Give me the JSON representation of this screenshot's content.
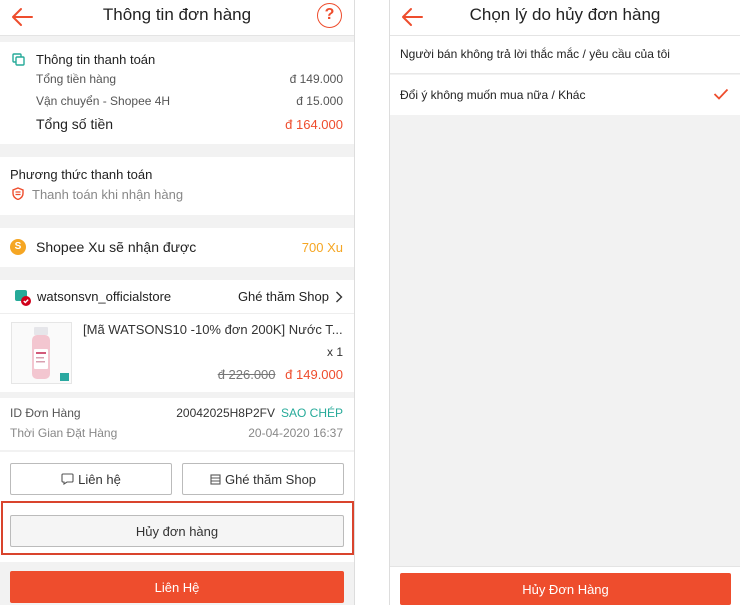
{
  "order_info": {
    "header": {
      "title": "Thông tin đơn hàng",
      "help_symbol": "?"
    },
    "payment_info": {
      "heading": "Thông tin thanh toán",
      "rows": [
        {
          "label": "Tổng tiền hàng",
          "value": "đ 149.000"
        },
        {
          "label": "Vận chuyển - Shopee 4H",
          "value": "đ 15.000"
        }
      ],
      "total_label": "Tổng số tiền",
      "total_value": "đ 164.000"
    },
    "payment_method": {
      "heading": "Phương thức thanh toán",
      "value": "Thanh toán khi nhận hàng"
    },
    "coins": {
      "label": "Shopee Xu sẽ nhận được",
      "value": "700 Xu",
      "coin_symbol": "S"
    },
    "shop": {
      "name": "watsonsvn_officialstore",
      "visit_label": "Ghé thăm Shop",
      "product": {
        "title": "[Mã WATSONS10 -10% đơn 200K] Nước T...",
        "quantity": "x 1",
        "original_price": "đ 226.000",
        "price": "đ 149.000"
      }
    },
    "order_meta": {
      "id_label": "ID Đơn Hàng",
      "id_value": "20042025H8P2FV",
      "copy_label": "SAO CHÉP",
      "time_label": "Thời Gian Đặt Hàng",
      "time_value": "20-04-2020 16:37"
    },
    "actions": {
      "contact_label": "Liên hệ",
      "visit_shop_label": "Ghé thăm Shop",
      "cancel_label": "Hủy đơn hàng",
      "primary_contact_label": "Liên Hệ"
    }
  },
  "cancel_reason": {
    "header": {
      "title": "Chọn lý do hủy đơn hàng"
    },
    "reasons": [
      {
        "label": "Người bán không trả lời thắc mắc / yêu cầu của tôi",
        "selected": false
      },
      {
        "label": "Đổi ý không muốn mua nữa / Khác",
        "selected": true
      }
    ],
    "confirm_label": "Hủy Đơn Hàng"
  },
  "colors": {
    "accent": "#ee4d2d",
    "coins": "#f5a623",
    "copy": "#26aa99",
    "highlight": "#d9442d"
  },
  "icons": [
    "back-arrow-icon",
    "help-icon",
    "payment-card-icon",
    "cod-shield-icon",
    "coin-icon",
    "shop-badge-icon",
    "chevron-right-icon",
    "chat-icon",
    "store-icon",
    "check-icon"
  ]
}
